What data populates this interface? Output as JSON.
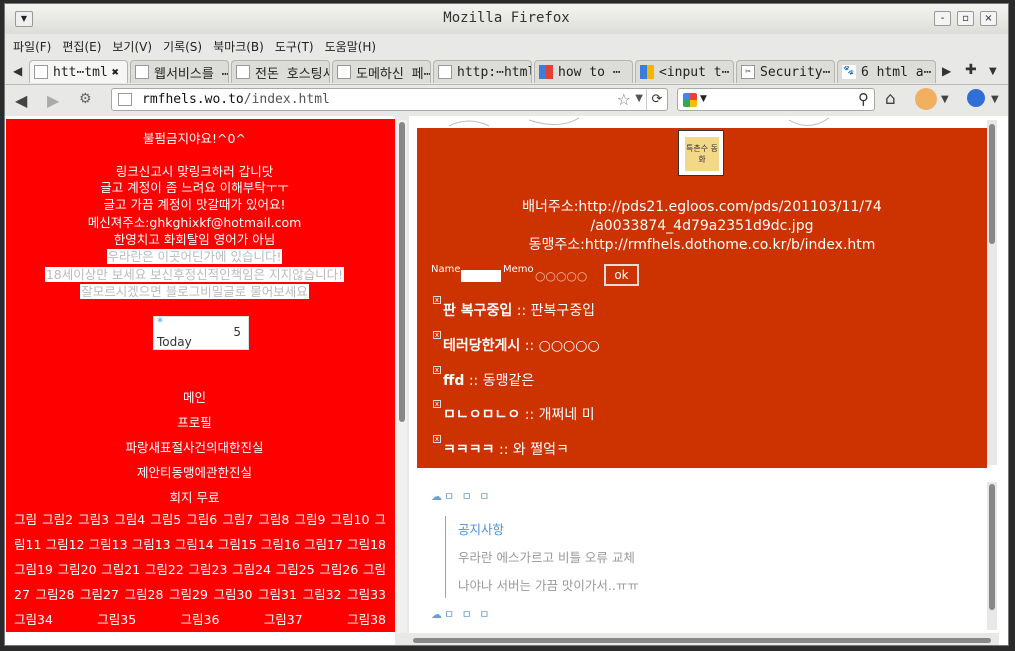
{
  "window": {
    "title": "Mozilla Firefox",
    "controls": [
      "-",
      "▫",
      "×"
    ]
  },
  "menu": [
    "파일(F)",
    "편집(E)",
    "보기(V)",
    "기록(S)",
    "북마크(B)",
    "도구(T)",
    "도움말(H)"
  ],
  "tabs": [
    {
      "label": "htt⋯tml",
      "active": true
    },
    {
      "label": "웹서비스를 ⋯",
      "active": false
    },
    {
      "label": "전돈 호스팅서⋯",
      "active": false
    },
    {
      "label": "도메하신 페⋯",
      "active": false
    },
    {
      "label": "http:⋯html",
      "active": false
    },
    {
      "label": "how to ⋯",
      "active": false
    },
    {
      "label": "<input t⋯",
      "active": false
    },
    {
      "label": "Security⋯",
      "active": false
    },
    {
      "label": "6 html a⋯",
      "active": false
    }
  ],
  "tab_close": "✖",
  "nav": {
    "url_host": "rmfhels.wo.to",
    "url_path": "/index.html"
  },
  "left": {
    "notice": "불펌금지야요!^0^",
    "lines": [
      "링크신고시 맞링크하러 갑니닷",
      "글고 계정이 좀 느려요 이해부탁ㅜㅜ",
      "글고 가끔 계정이 맛갈때가 있어요!",
      "메신져주소:ghkghixkf@hotmail.com",
      "한영치고 화회탈임 영어가 아님"
    ],
    "highlight_lines": [
      "우라란은 이곳어딘가에 있습니다!",
      "18세이상만 보세요 보신후정신적인책임은 지지않습니다!",
      "잘모르시겠으면 블로그비밀글로 물어보세요"
    ],
    "counter": {
      "star": "*",
      "label": "Today",
      "value": "5"
    },
    "nav_items": [
      "메인",
      "프로필",
      "파랑새표절사건의대한진실",
      "제안티동맹에관한진실",
      "회지 무료"
    ],
    "pictures": "그림 그림2 그림3 그림4 그림5 그림6 그림7 그림8 그림9 그림10 그림11 그림12 그림13 그림13 그림14 그림15 그림16 그림17 그림18 그림19 그림20 그림21 그림22 그림23 그림24 그림25 그림26 그림27 그림28 그림27 그림28 그림29 그림30 그림31 그림32 그림33 그림34 그림35 그림36 그림37 그림38"
  },
  "right": {
    "logo_text": "특촌수 동화",
    "banner_line1": "배너주소:http://pds21.egloos.com/pds/201103/11/74",
    "banner_line2": "/a0033874_4d79a2351d9dc.jpg",
    "banner_line3": "동맹주소:http://rmfhels.dothome.co.kr/b/index.htm",
    "form": {
      "name_label": "Name",
      "memo_label": "Memo",
      "memo_value": "○○○○○",
      "ok": "ok"
    },
    "posts": [
      {
        "title": "판 복구중입",
        "desc": ":: 판복구중입"
      },
      {
        "title": "테러당한게시",
        "desc": ":: ○○○○○"
      },
      {
        "title": "ffd",
        "desc": ":: 동맹같은"
      },
      {
        "title": "ㅁㄴㅇㅁㄴㅇ",
        "desc": ":: 개쩌네 미"
      },
      {
        "title": "ㅋㅋㅋㅋ",
        "desc": ":: 와 쩔엌ㅋ"
      }
    ],
    "cloud_label": "ㅁ ㅁ ㅁ",
    "board": {
      "title": "공지사항",
      "items": [
        "우라란 에스가르고 비틀 오류 교체",
        "나야나 서버는 가끔 맛이가서..ㅠㅠ"
      ]
    }
  },
  "colors": {
    "left_bg": "#ff0000",
    "right_bg": "#cc3300",
    "link_blue": "#4a90d9"
  }
}
